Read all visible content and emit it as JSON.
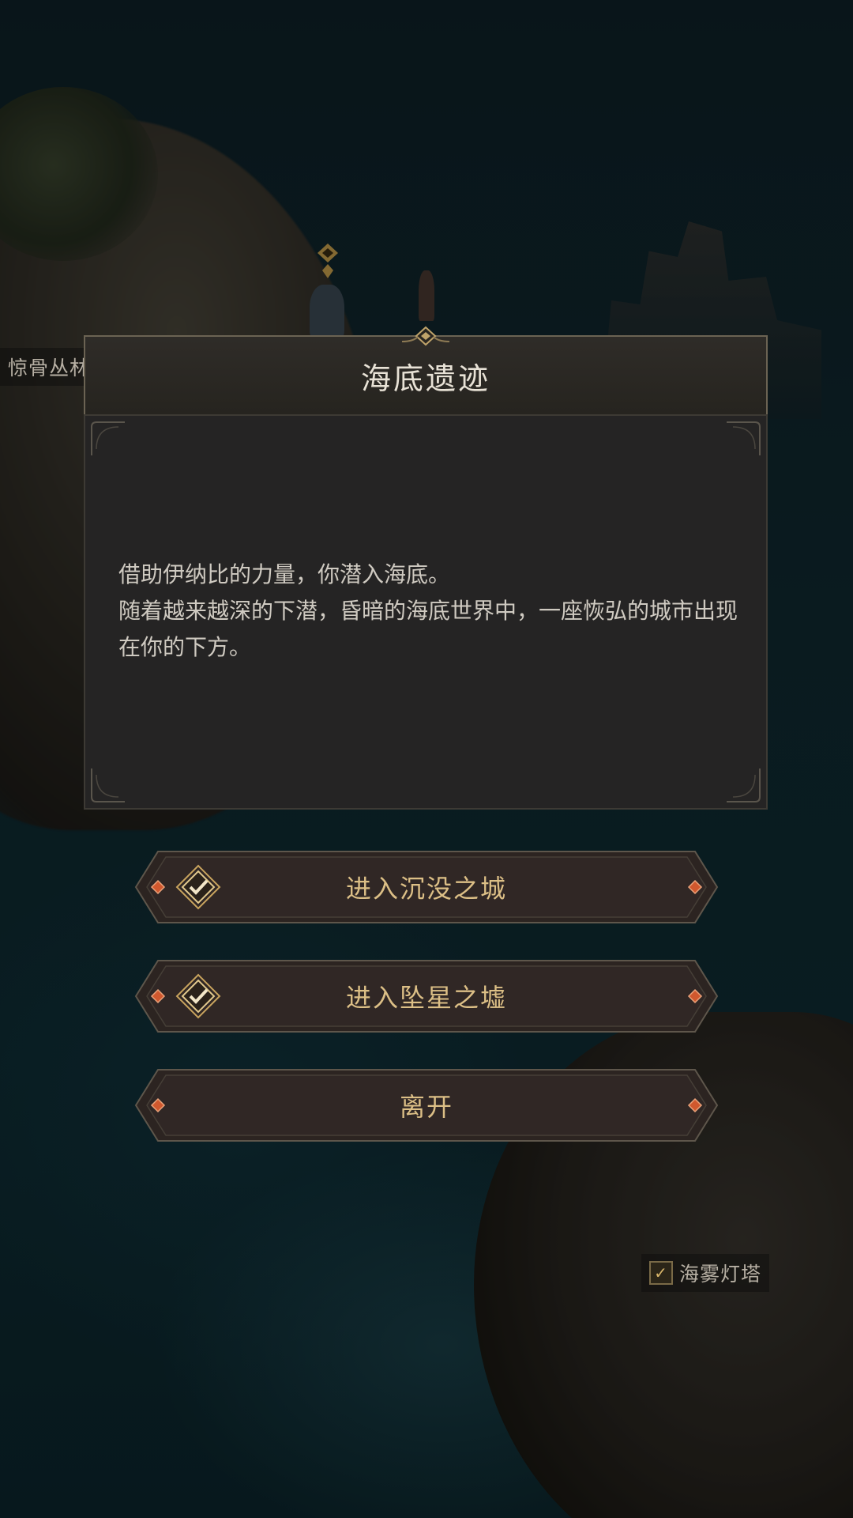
{
  "map": {
    "label_left": "惊骨丛林",
    "label_lighthouse": "海雾灯塔",
    "lighthouse_visited": true
  },
  "dialog": {
    "title": "海底遗迹",
    "story": [
      "借助伊纳比的力量，你潜入海底。",
      "随着越来越深的下潜，昏暗的海底世界中，一座恢弘的城市出现在你的下方。"
    ]
  },
  "options": [
    {
      "label": "进入沉没之城",
      "completed": true,
      "icon": "check-diamond-icon"
    },
    {
      "label": "进入坠星之墟",
      "completed": true,
      "icon": "check-diamond-icon"
    },
    {
      "label": "离开",
      "completed": false
    }
  ],
  "colors": {
    "gold": "#dcbf86",
    "gem": "#d0582e",
    "panel": "#252424",
    "frame": "#6b6353"
  }
}
